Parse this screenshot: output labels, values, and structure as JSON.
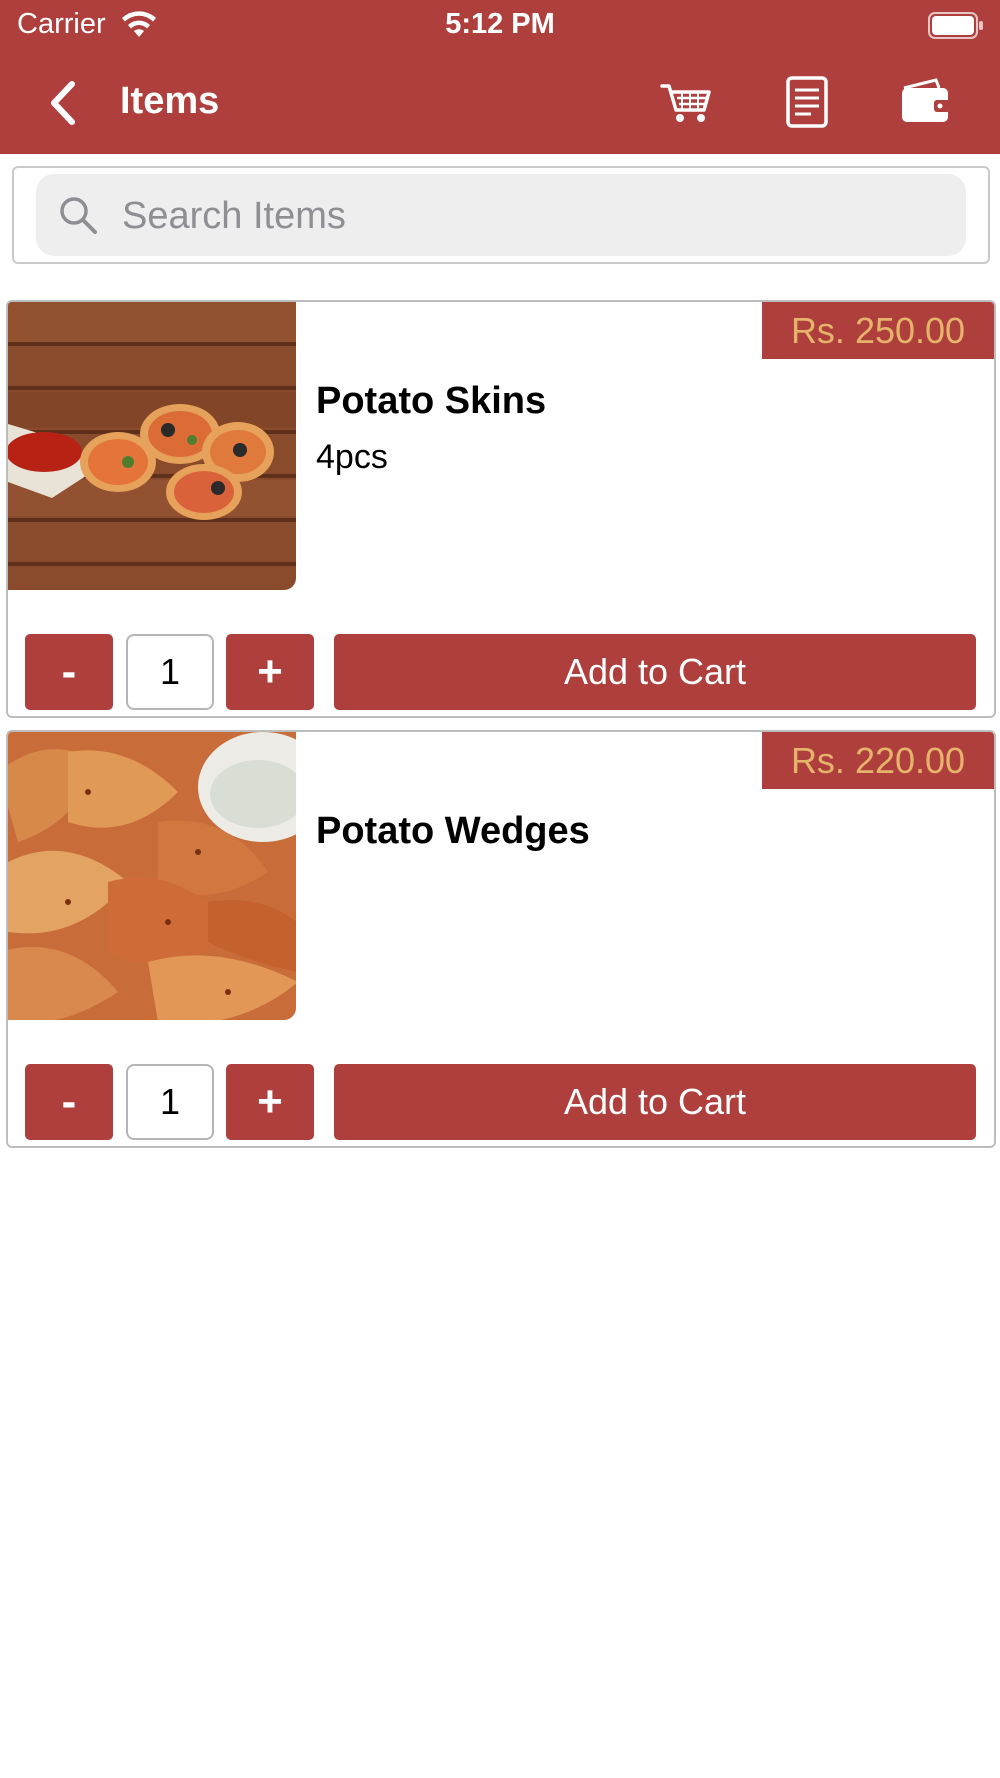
{
  "status_bar": {
    "carrier": "Carrier",
    "time": "5:12 PM"
  },
  "nav": {
    "title": "Items",
    "icons": [
      "back-chevron-icon",
      "cart-icon",
      "orders-icon",
      "wallet-icon"
    ]
  },
  "search": {
    "placeholder": "Search Items",
    "value": ""
  },
  "items": [
    {
      "price": "Rs. 250.00",
      "name": "Potato Skins",
      "description": "4pcs",
      "quantity": "1",
      "minus_label": "-",
      "plus_label": "+",
      "add_label": "Add to Cart"
    },
    {
      "price": "Rs. 220.00",
      "name": "Potato Wedges",
      "description": "",
      "quantity": "1",
      "minus_label": "-",
      "plus_label": "+",
      "add_label": "Add to Cart"
    }
  ],
  "colors": {
    "brand": "#ae3f3d",
    "price_text": "#e6b36a",
    "search_bg": "#eeeeef"
  }
}
